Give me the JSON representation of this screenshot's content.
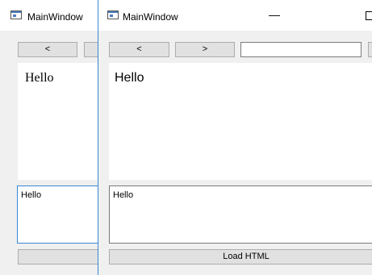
{
  "window_back": {
    "title": "MainWindow",
    "back_label": "<",
    "view_text": "Hello",
    "editor_value": "Hello"
  },
  "window_front": {
    "title": "MainWindow",
    "back_label": "<",
    "forward_label": ">",
    "url_value": "",
    "view_text": "Hello",
    "editor_value": "Hello",
    "load_button_label": "Load HTML",
    "minimize_glyph": "—"
  },
  "colors": {
    "window_bg": "#f0f0f0",
    "focus_border": "#3a87d4",
    "button_bg": "#e1e1e1"
  }
}
